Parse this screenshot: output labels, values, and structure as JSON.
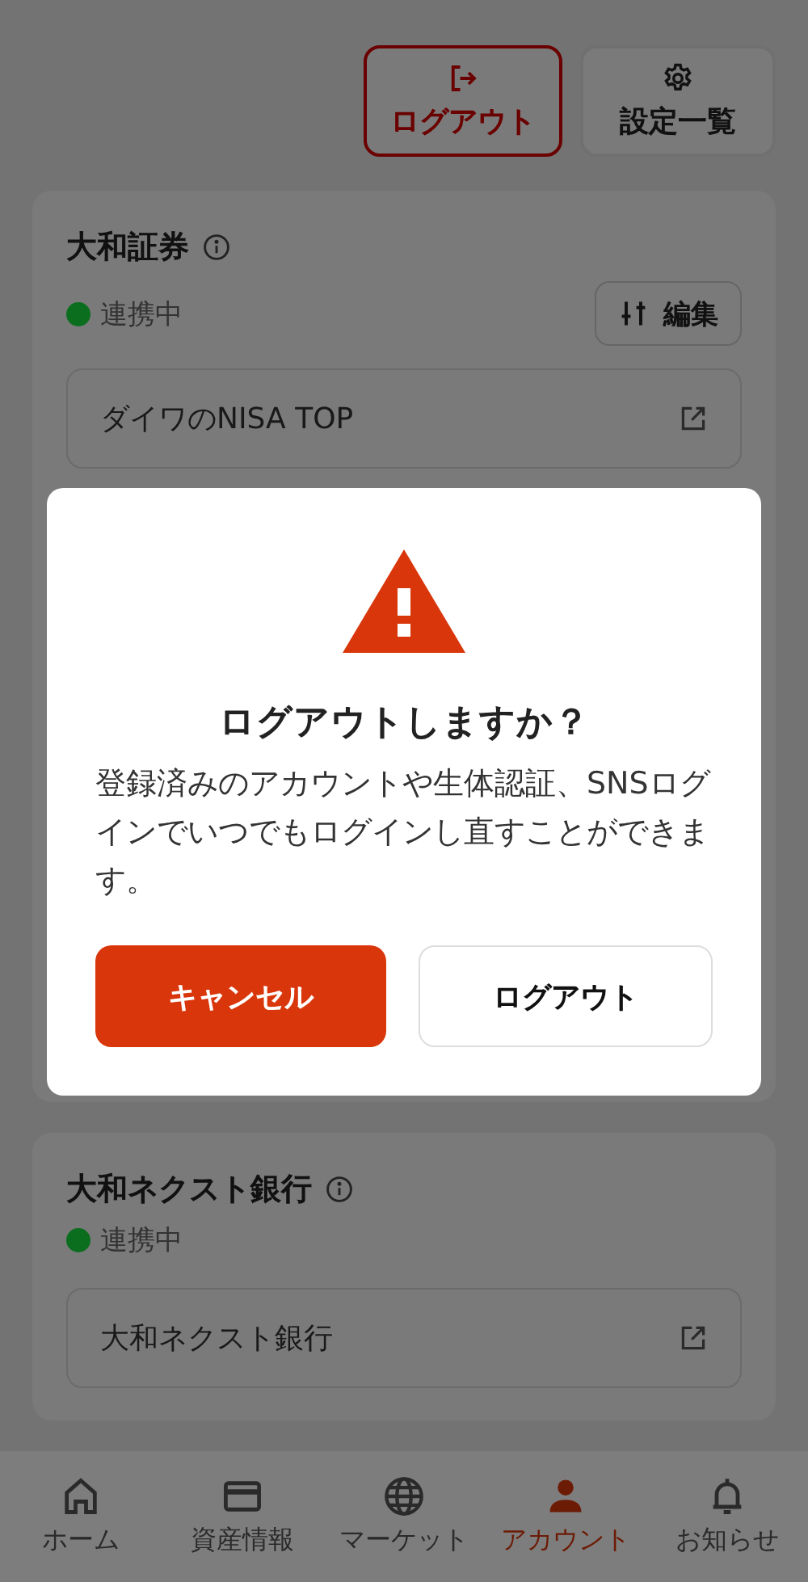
{
  "header_buttons": [
    {
      "label": "ログアウト",
      "kind": "danger"
    },
    {
      "label": "設定一覧",
      "kind": "normal"
    }
  ],
  "accounts": [
    {
      "name": "大和証券",
      "status": "連携中",
      "color": "#0a6e1e",
      "edit_button": "編集",
      "links": [
        "ダイワのNISA TOP"
      ]
    },
    {
      "name": "大和ネクスト銀行",
      "status": "連携中",
      "color": "#0a6e1e",
      "links": [
        "大和ネクスト銀行"
      ]
    }
  ],
  "dialog": {
    "title": "ログアウトしますか？",
    "message": "登録済みのアカウントや生体認証、SNSログインでいつでもログインし直すことができます。",
    "buttons": [
      {
        "label": "キャンセル",
        "kind": "primary"
      },
      {
        "label": "ログアウト",
        "kind": "secondary"
      }
    ]
  },
  "nav": [
    {
      "kind": "home",
      "label": "ホーム",
      "selected": false
    },
    {
      "kind": "assets",
      "label": "資産情報",
      "selected": false
    },
    {
      "kind": "market",
      "label": "マーケット",
      "selected": false
    },
    {
      "kind": "account",
      "label": "アカウント",
      "selected": true
    },
    {
      "kind": "news",
      "label": "お知らせ",
      "selected": false
    }
  ]
}
